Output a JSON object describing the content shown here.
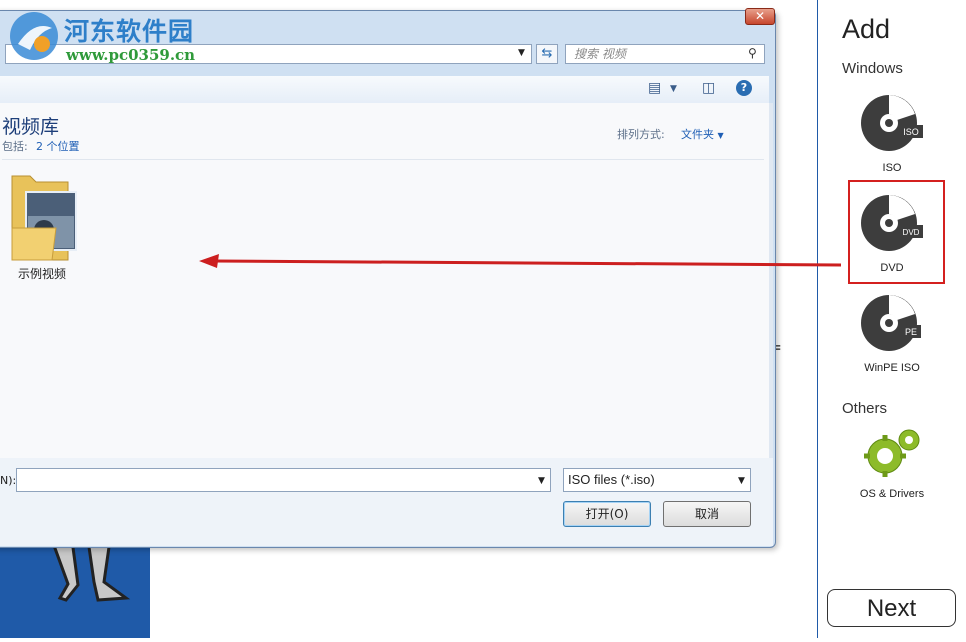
{
  "watermark": {
    "site_name": "河东软件园",
    "url": "www.pc0359.cn"
  },
  "dialog": {
    "address_value": "",
    "search_placeholder": "搜索 视频",
    "library_title": "视频库",
    "library_includes_label": "包括:",
    "library_includes_link": "2 个位置",
    "arrange_label": "排列方式:",
    "arrange_value": "文件夹",
    "folder_name": "示例视频",
    "filename_label": "N):",
    "filename_value": "",
    "filetype_value": "ISO files (*.iso)",
    "open_button": "打开(O)",
    "cancel_button": "取消",
    "close_glyph": "✕"
  },
  "add_panel": {
    "title": "Add",
    "windows_section": "Windows",
    "items": [
      {
        "label": "ISO",
        "badge": "ISO"
      },
      {
        "label": "DVD",
        "badge": "DVD"
      },
      {
        "label": "WinPE ISO",
        "badge": "PE"
      }
    ],
    "others_section": "Others",
    "others_item": "OS & Drivers",
    "next_button": "Next"
  },
  "colors": {
    "accent_blue": "#1f5aa8",
    "highlight_red": "#d4201f",
    "arrow_red": "#cc1f1f"
  }
}
